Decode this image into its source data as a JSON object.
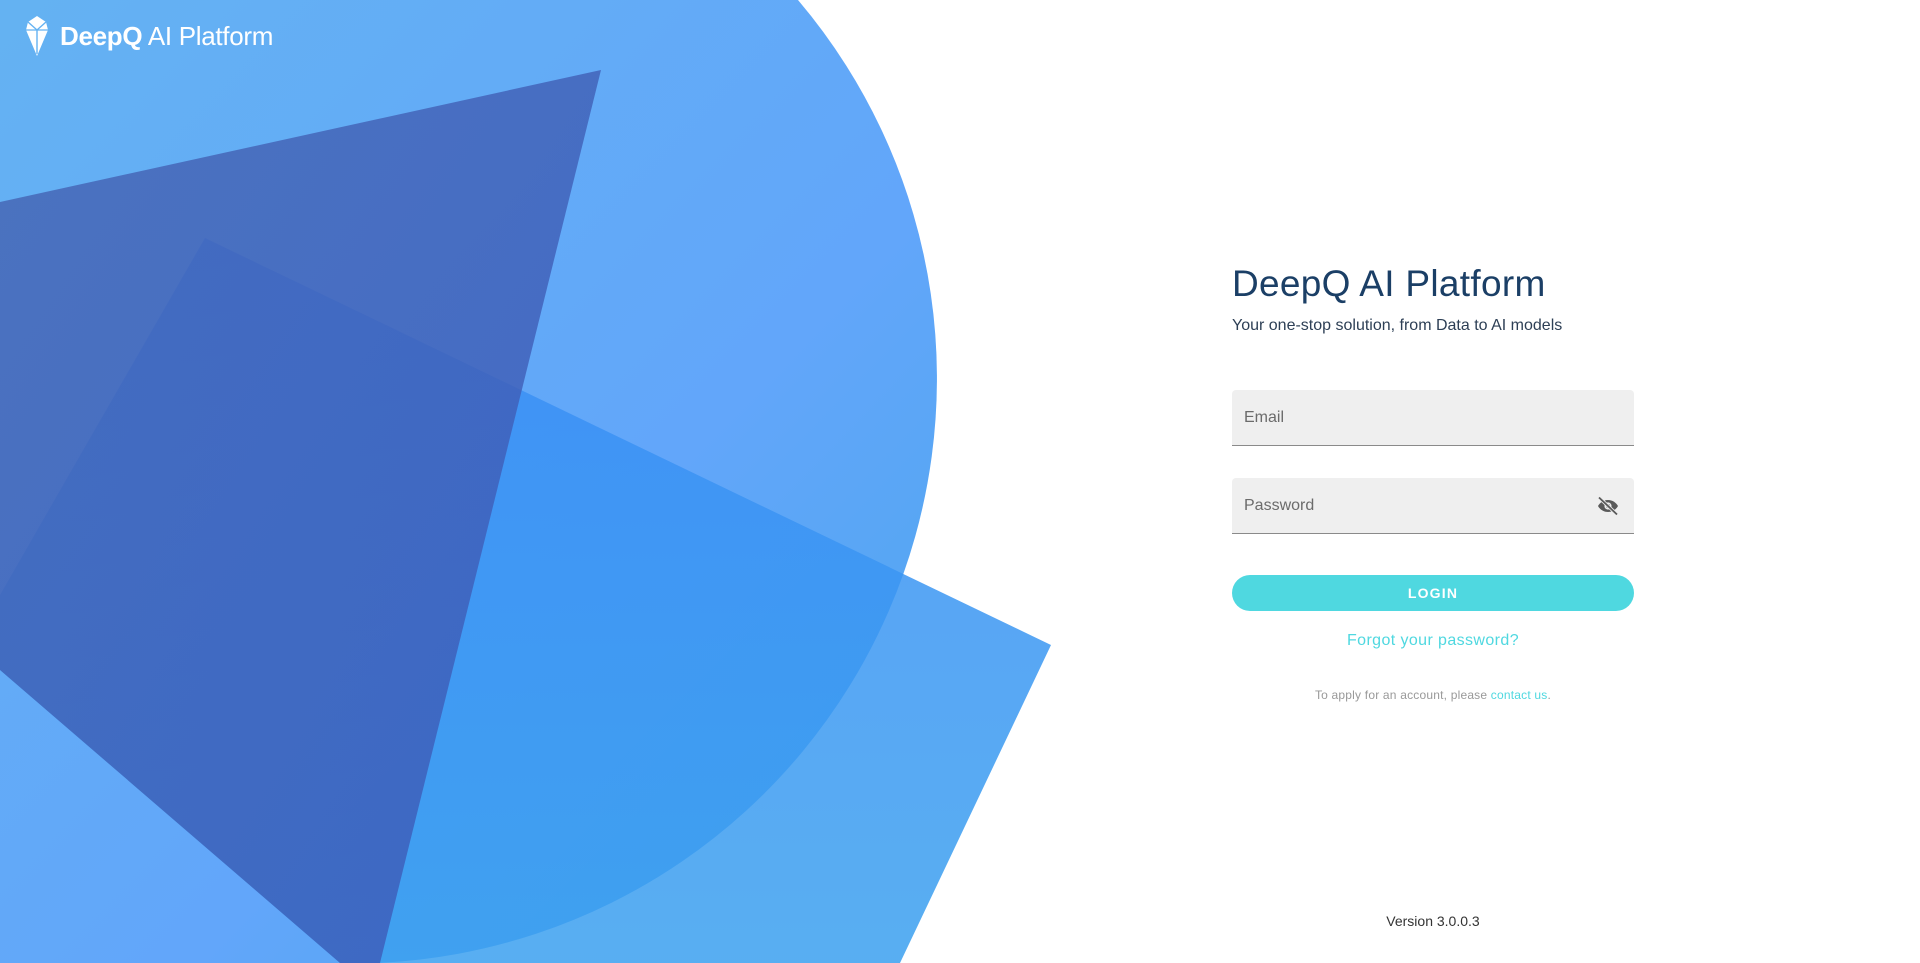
{
  "brand": {
    "logo_icon": "deepq-gem-logo",
    "name_bold": "DeepQ",
    "name_light": "AI Platform"
  },
  "login": {
    "title": "DeepQ AI Platform",
    "subtitle": "Your one-stop solution, from Data to AI models",
    "email_placeholder": "Email",
    "password_placeholder": "Password",
    "password_toggle_icon": "eye-off-icon",
    "login_label": "LOGIN",
    "forgot_label": "Forgot your password?",
    "apply_text": "To apply for an account, please ",
    "contact_label": "contact us",
    "apply_suffix": "."
  },
  "footer": {
    "version": "Version 3.0.0.3"
  },
  "colors": {
    "accent": "#4fd8e0",
    "title": "#1b3f66",
    "art_light": "#64b4f4",
    "art_dark": "#3b5bb5"
  }
}
